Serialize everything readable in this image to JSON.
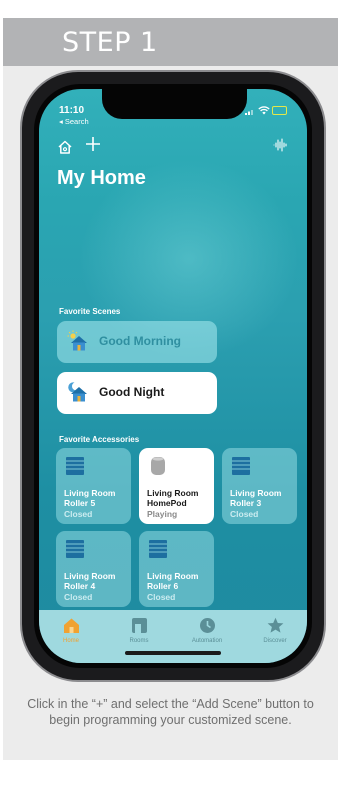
{
  "step": {
    "label": "STEP 1"
  },
  "status": {
    "time": "11:10",
    "back_label": "◂ Search"
  },
  "header": {
    "title": "My Home"
  },
  "scenes": {
    "section_label": "Favorite Scenes",
    "items": [
      {
        "name": "Good Morning",
        "state": "inactive"
      },
      {
        "name": "Good Night",
        "state": "active"
      }
    ]
  },
  "accessories": {
    "section_label": "Favorite Accessories",
    "items": [
      {
        "line1": "Living Room",
        "line2": "Roller 5",
        "status": "Closed",
        "type": "roller-blind"
      },
      {
        "line1": "Living Room",
        "line2": "HomePod",
        "status": "Playing",
        "type": "homepod"
      },
      {
        "line1": "Living Room",
        "line2": "Roller 3",
        "status": "Closed",
        "type": "roller-blind"
      },
      {
        "line1": "Living Room",
        "line2": "Roller 4",
        "status": "Closed",
        "type": "roller-blind"
      },
      {
        "line1": "Living Room",
        "line2": "Roller 6",
        "status": "Closed",
        "type": "roller-blind"
      }
    ]
  },
  "tabbar": {
    "items": [
      {
        "label": "Home",
        "icon": "home-tab-icon",
        "active": true
      },
      {
        "label": "Rooms",
        "icon": "rooms-tab-icon",
        "active": false
      },
      {
        "label": "Automation",
        "icon": "automation-tab-icon",
        "active": false
      },
      {
        "label": "Discover",
        "icon": "star-tab-icon",
        "active": false
      }
    ]
  },
  "caption": {
    "text": "Click in the “+” and select the “Add Scene” button to begin programming your customized scene."
  },
  "colors": {
    "step_bar": "#b2b3b5",
    "screen_teal": "#2aa6b2",
    "active_tab": "#f0a232"
  }
}
